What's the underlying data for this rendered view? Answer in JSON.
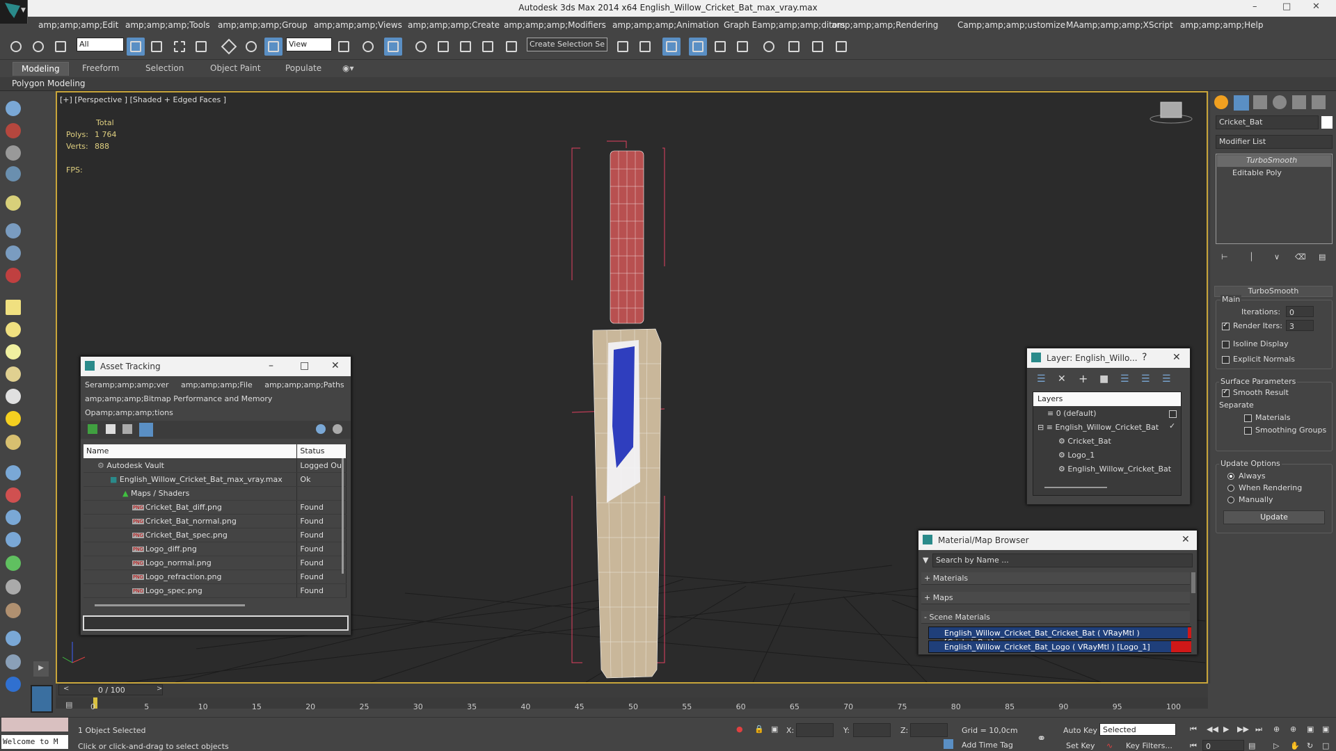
{
  "window": {
    "title": "Autodesk 3ds Max  2014 x64    English_Willow_Cricket_Bat_max_vray.max",
    "controls": [
      "–",
      "□",
      "✕"
    ]
  },
  "menu": [
    "amp;amp;amp;Edit",
    "amp;amp;amp;Tools",
    "amp;amp;amp;Group",
    "amp;amp;amp;Views",
    "amp;amp;amp;Create",
    "amp;amp;amp;Modifiers",
    "amp;amp;amp;Animation",
    "Graph Eamp;amp;amp;ditors",
    "amp;amp;amp;Rendering",
    "Camp;amp;amp;ustomize",
    "MAamp;amp;amp;XScript",
    "amp;amp;amp;Help"
  ],
  "toolbar": {
    "selection_filter": "All",
    "reference_coord": "View",
    "named_selection": "Create Selection Se"
  },
  "ribbon": {
    "tabs": [
      "Modeling",
      "Freeform",
      "Selection",
      "Object Paint",
      "Populate"
    ],
    "active_tab": "Modeling",
    "panel_label": "Polygon Modeling"
  },
  "viewport": {
    "label": "[+] [Perspective ] [Shaded + Edged Faces ]",
    "stats": {
      "total_label": "Total",
      "polys_label": "Polys:",
      "polys_value": "1 764",
      "verts_label": "Verts:",
      "verts_value": "888",
      "fps_label": "FPS:"
    }
  },
  "command_panel": {
    "object_name": "Cricket_Bat",
    "modifier_list": "Modifier List",
    "stack": [
      "TurboSmooth",
      "Editable Poly"
    ],
    "rollout_title": "TurboSmooth",
    "main_label": "Main",
    "iterations_label": "Iterations:",
    "iterations_value": "0",
    "render_iters_label": "Render Iters:",
    "render_iters_value": "3",
    "isoline": "Isoline Display",
    "explicit_normals": "Explicit Normals",
    "surface_params": "Surface Parameters",
    "smooth_result": "Smooth Result",
    "separate": "Separate",
    "materials": "Materials",
    "smoothing_groups": "Smoothing Groups",
    "update_options": "Update Options",
    "always": "Always",
    "when_rendering": "When Rendering",
    "manually": "Manually",
    "update_button": "Update"
  },
  "asset_tracking": {
    "title": "Asset Tracking",
    "menu_line1": "Seramp;amp;amp;ver     amp;amp;amp;File     amp;amp;amp;Paths",
    "menu_line2": "amp;amp;amp;Bitmap Performance and Memory",
    "menu_line3": "Opamp;amp;amp;tions",
    "col_name": "Name",
    "col_status": "Status",
    "rows": [
      {
        "name": "Autodesk Vault",
        "status": "Logged Ou",
        "indent": 1,
        "icon": "vault"
      },
      {
        "name": "English_Willow_Cricket_Bat_max_vray.max",
        "status": "Ok",
        "indent": 2,
        "icon": "max"
      },
      {
        "name": "Maps / Shaders",
        "status": "",
        "indent": 3,
        "icon": "maps"
      },
      {
        "name": "Cricket_Bat_diff.png",
        "status": "Found",
        "indent": 4,
        "icon": "png"
      },
      {
        "name": "Cricket_Bat_normal.png",
        "status": "Found",
        "indent": 4,
        "icon": "png"
      },
      {
        "name": "Cricket_Bat_spec.png",
        "status": "Found",
        "indent": 4,
        "icon": "png"
      },
      {
        "name": "Logo_diff.png",
        "status": "Found",
        "indent": 4,
        "icon": "png"
      },
      {
        "name": "Logo_normal.png",
        "status": "Found",
        "indent": 4,
        "icon": "png"
      },
      {
        "name": "Logo_refraction.png",
        "status": "Found",
        "indent": 4,
        "icon": "png"
      },
      {
        "name": "Logo_spec.png",
        "status": "Found",
        "indent": 4,
        "icon": "png"
      }
    ]
  },
  "layer_window": {
    "title": "Layer: English_Willo...",
    "help": "?",
    "header": "Layers",
    "items": [
      {
        "label": "0 (default)",
        "indent": 1
      },
      {
        "label": "English_Willow_Cricket_Bat",
        "indent": 1
      },
      {
        "label": "Cricket_Bat",
        "indent": 2
      },
      {
        "label": "Logo_1",
        "indent": 2
      },
      {
        "label": "English_Willow_Cricket_Bat",
        "indent": 2
      }
    ]
  },
  "material_browser": {
    "title": "Material/Map Browser",
    "search_placeholder": "Search by Name ...",
    "sections": [
      "+ Materials",
      "+ Maps",
      "- Scene Materials"
    ],
    "materials": [
      "English_Willow_Cricket_Bat_Cricket_Bat  ( VRayMtl )  [Cricket_Bat]",
      "English_Willow_Cricket_Bat_Logo  ( VRayMtl )  [Logo_1]"
    ],
    "accent": "#d01818"
  },
  "timeline": {
    "frame_display": "0 / 100",
    "ticks": [
      "0",
      "5",
      "10",
      "15",
      "20",
      "25",
      "30",
      "35",
      "40",
      "45",
      "50",
      "55",
      "60",
      "65",
      "70",
      "75",
      "80",
      "85",
      "90",
      "95",
      "100"
    ]
  },
  "status": {
    "welcome": "Welcome to M",
    "selected": "1 Object Selected",
    "prompt": "Click or click-and-drag to select objects",
    "x_label": "X:",
    "y_label": "Y:",
    "z_label": "Z:",
    "grid": "Grid = 10,0cm",
    "auto_key": "Auto Key",
    "set_key": "Set Key",
    "key_mode": "Selected",
    "key_filters": "Key Filters...",
    "add_time_tag": "Add Time Tag",
    "frame_value": "0"
  }
}
